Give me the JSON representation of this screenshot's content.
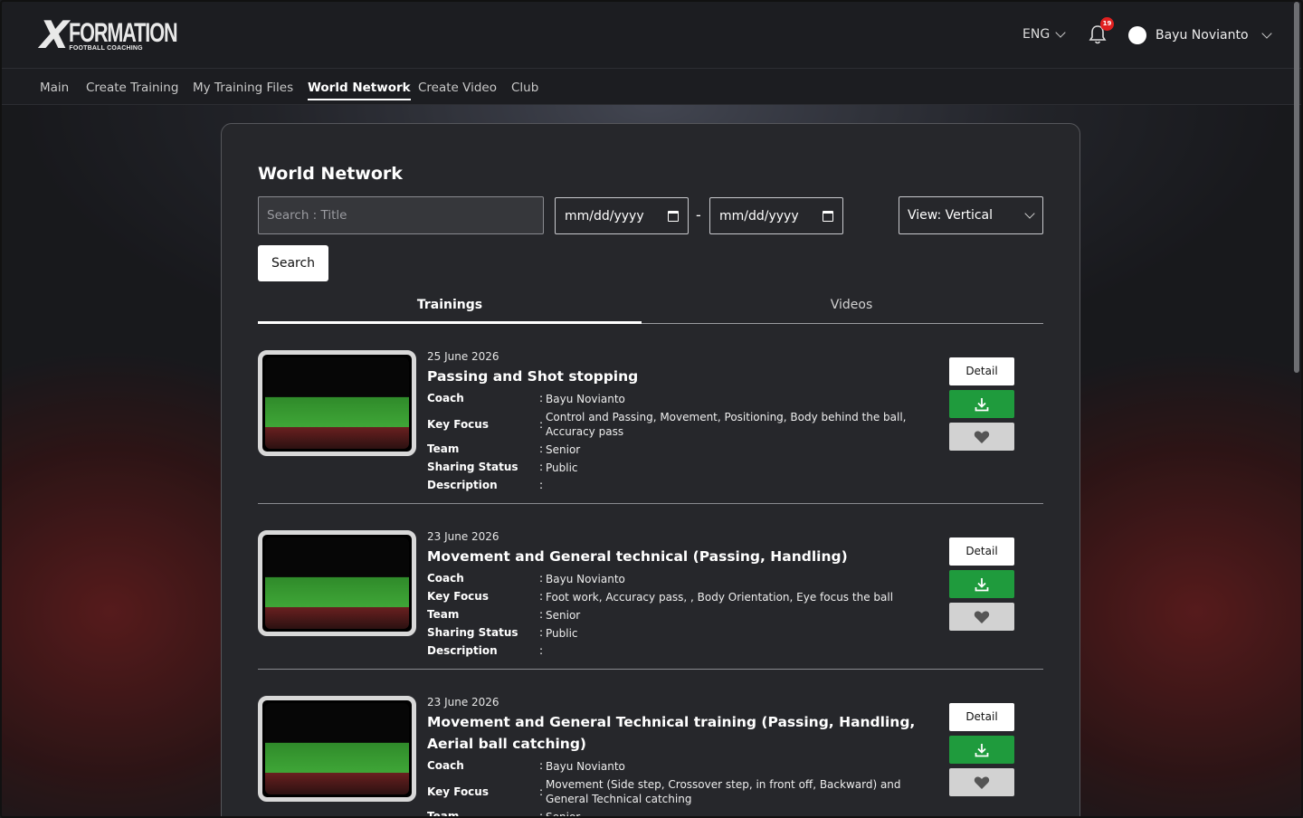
{
  "brand": {
    "logo_mark": "X",
    "logo_main": "FORMATION",
    "logo_sub": "FOOTBALL COACHING"
  },
  "header": {
    "language": "ENG",
    "notification_count": "19",
    "user_name": "Bayu Novianto"
  },
  "nav": {
    "items": [
      "Main",
      "Create Training",
      "My Training Files",
      "World Network",
      "Create Video",
      "Club"
    ],
    "active": "World Network"
  },
  "page": {
    "title": "World Network",
    "search_placeholder": "Search : Title",
    "date_from_placeholder": "mm/dd/yyyy",
    "date_to_placeholder": "mm/dd/yyyy",
    "date_separator": "-",
    "view_select": "View: Vertical",
    "search_button": "Search",
    "tabs": [
      "Trainings",
      "Videos"
    ],
    "active_tab": "Trainings"
  },
  "labels": {
    "coach": "Coach",
    "key_focus": "Key Focus",
    "team": "Team",
    "sharing_status": "Sharing Status",
    "description": "Description",
    "colon": ":",
    "detail": "Detail"
  },
  "items": [
    {
      "date": "25 June 2026",
      "title": "Passing and Shot stopping",
      "coach": "Bayu Novianto",
      "key_focus": "Control and Passing, Movement, Positioning, Body behind the ball, Accuracy pass",
      "team": "Senior",
      "sharing_status": "Public",
      "description": ""
    },
    {
      "date": "23 June 2026",
      "title": "Movement and General technical (Passing, Handling)",
      "coach": "Bayu Novianto",
      "key_focus": "Foot work, Accuracy pass, , Body Orientation, Eye focus the ball",
      "team": "Senior",
      "sharing_status": "Public",
      "description": ""
    },
    {
      "date": "23 June 2026",
      "title": "Movement and General Technical training (Passing, Handling, Aerial ball catching)",
      "coach": "Bayu Novianto",
      "key_focus": "Movement (Side step, Crossover step, in front off, Backward) and General Technical catching",
      "team": "Senior",
      "sharing_status": "",
      "description": ""
    }
  ],
  "icons": {
    "download": "download-icon",
    "favorite": "heart-icon",
    "bell": "bell-icon",
    "calendar": "calendar-icon",
    "chevron": "chevron-down-icon"
  },
  "colors": {
    "download_green": "#1f9b3d",
    "badge_red": "#e02020",
    "card_bg": "#26272b"
  }
}
